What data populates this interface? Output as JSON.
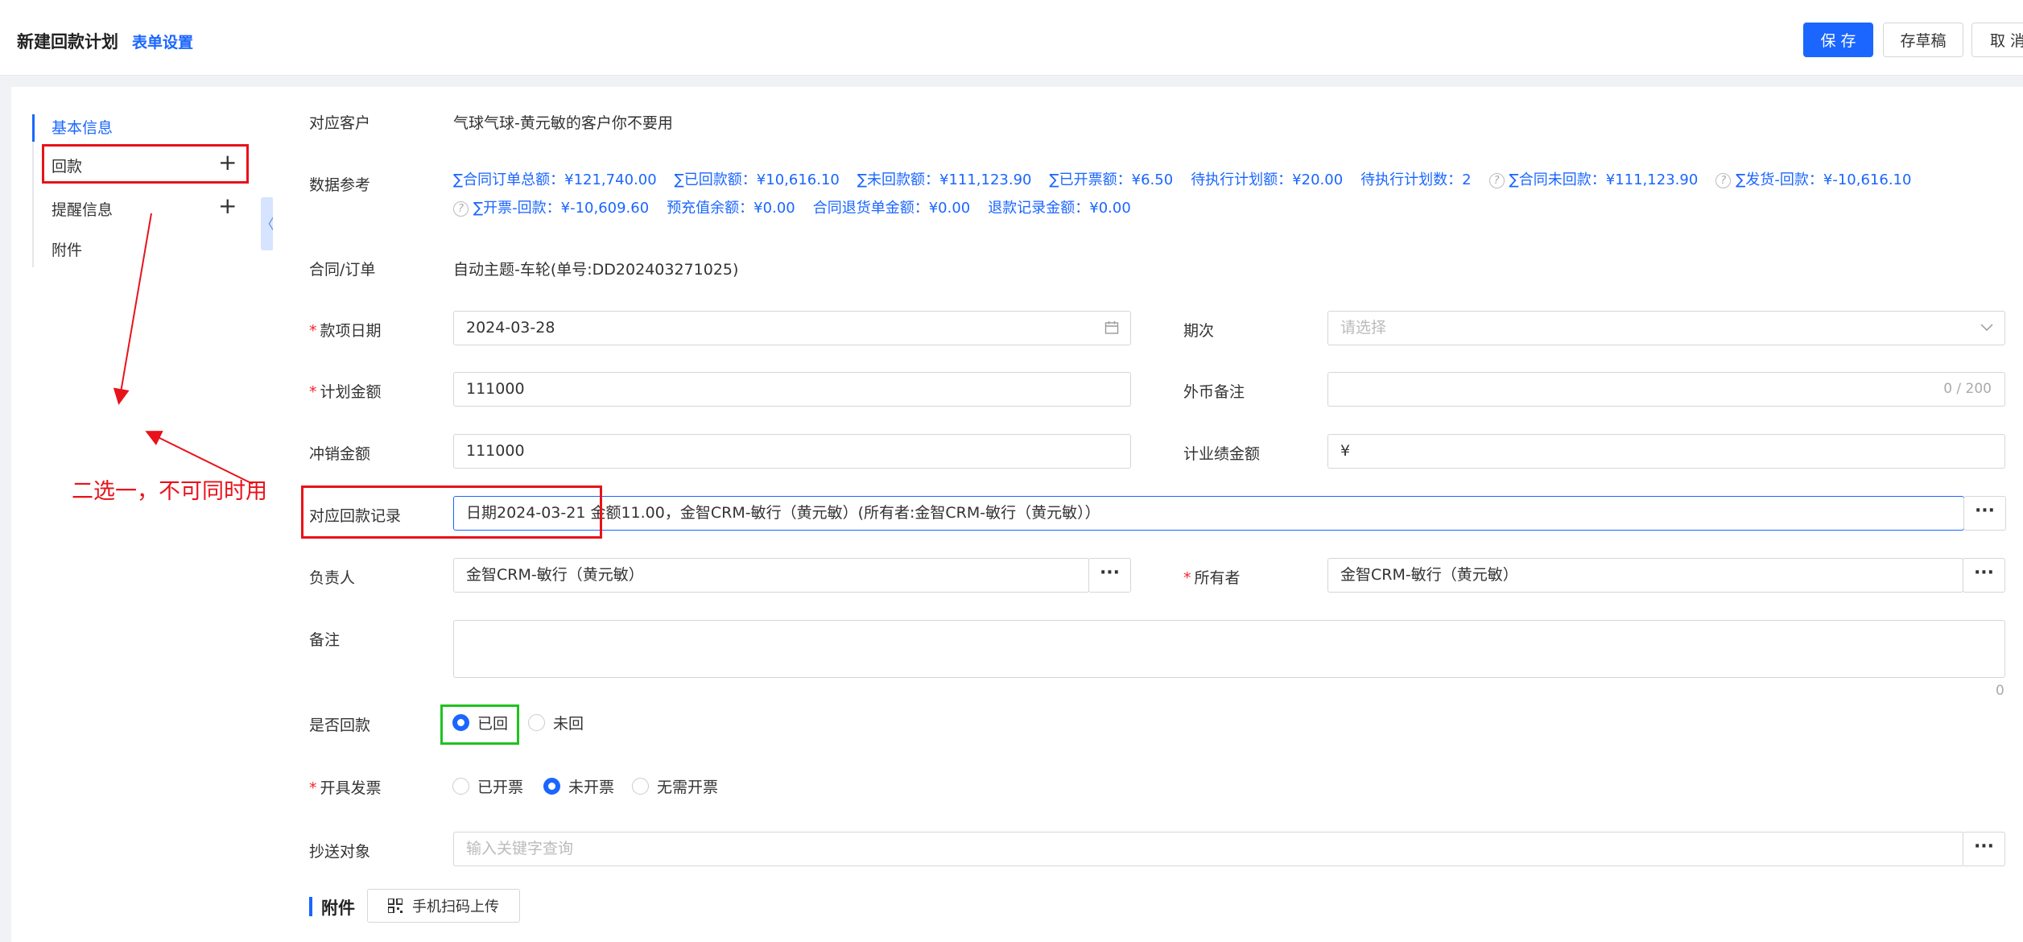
{
  "header": {
    "title": "新建回款计划",
    "form_settings": "表单设置",
    "save": "保 存",
    "draft": "存草稿",
    "cancel": "取 消"
  },
  "sidebar": {
    "items": [
      {
        "label": "基本信息"
      },
      {
        "label": "回款"
      },
      {
        "label": "提醒信息"
      },
      {
        "label": "附件"
      }
    ],
    "collapse_icon": "〈"
  },
  "form": {
    "customer": {
      "label": "对应客户",
      "value": "气球气球-黄元敏的客户你不要用"
    },
    "reference": {
      "label": "数据参考",
      "line1": [
        "∑合同订单总额：¥121,740.00",
        "∑已回款额：¥10,616.10",
        "∑未回款额：¥111,123.90",
        "∑已开票额：¥6.50",
        "待执行计划额：¥20.00",
        "待执行计划数：2",
        "∑合同未回款：¥111,123.90",
        "∑发货-回款：¥-10,616.10"
      ],
      "line2": [
        "∑开票-回款：¥-10,609.60",
        "预充值余额：¥0.00",
        "合同退货单金额：¥0.00",
        "退款记录金额：¥0.00"
      ]
    },
    "contract": {
      "label": "合同/订单",
      "value": "自动主题-车轮(单号:DD202403271025)"
    },
    "payment_date": {
      "label": "款项日期",
      "value": "2024-03-28"
    },
    "period": {
      "label": "期次",
      "placeholder": "请选择"
    },
    "planned_amount": {
      "label": "计划金额",
      "value": "111000"
    },
    "currency_note": {
      "label": "外币备注",
      "counter": "0 / 200"
    },
    "offset_amount": {
      "label": "冲销金额",
      "value": "111000"
    },
    "performance_amount": {
      "label": "计业绩金额",
      "value": "¥"
    },
    "payment_record": {
      "label": "对应回款记录",
      "value": "日期2024-03-21 金额11.00，金智CRM-敏行（黄元敏）(所有者:金智CRM-敏行（黄元敏））"
    },
    "owner_person": {
      "label": "负责人",
      "value": "金智CRM-敏行（黄元敏）"
    },
    "owner": {
      "label": "所有者",
      "value": "金智CRM-敏行（黄元敏）"
    },
    "remark": {
      "label": "备注",
      "counter": "0"
    },
    "is_paid": {
      "label": "是否回款",
      "options": [
        "已回",
        "未回"
      ],
      "selected": "已回"
    },
    "invoice": {
      "label": "开具发票",
      "options": [
        "已开票",
        "未开票",
        "无需开票"
      ],
      "selected": "未开票"
    },
    "cc": {
      "label": "抄送对象",
      "placeholder": "输入关键字查询"
    },
    "dots": "···"
  },
  "attachments": {
    "title": "附件",
    "scan_upload": "手机扫码上传"
  },
  "annotation": {
    "text": "二选一，不可同时用",
    "color": "#e8121a"
  },
  "colors": {
    "primary": "#1a66ff",
    "required": "#f5222d"
  }
}
